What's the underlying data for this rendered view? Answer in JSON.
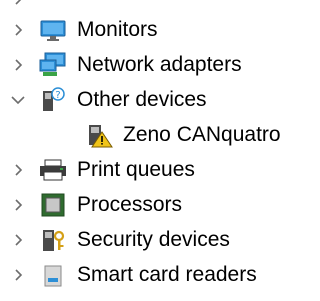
{
  "device_manager": {
    "items": [
      {
        "label": "",
        "icon": "partial-device-icon",
        "state": "collapsed"
      },
      {
        "label": "Monitors",
        "icon": "monitor-icon",
        "state": "collapsed"
      },
      {
        "label": "Network adapters",
        "icon": "network-adapter-icon",
        "state": "collapsed"
      },
      {
        "label": "Other devices",
        "icon": "unknown-device-icon",
        "state": "expanded",
        "children": [
          {
            "label": "Zeno CANquatro",
            "icon": "warning-device-icon"
          }
        ]
      },
      {
        "label": "Print queues",
        "icon": "printer-icon",
        "state": "collapsed"
      },
      {
        "label": "Processors",
        "icon": "processor-icon",
        "state": "collapsed"
      },
      {
        "label": "Security devices",
        "icon": "security-device-icon",
        "state": "collapsed"
      },
      {
        "label": "Smart card readers",
        "icon": "smart-card-reader-icon",
        "state": "collapsed"
      }
    ]
  },
  "colors": {
    "chevron": "#6d6d6d",
    "monitor_blue": "#2d8fd6",
    "warning_yellow": "#f0c419"
  }
}
